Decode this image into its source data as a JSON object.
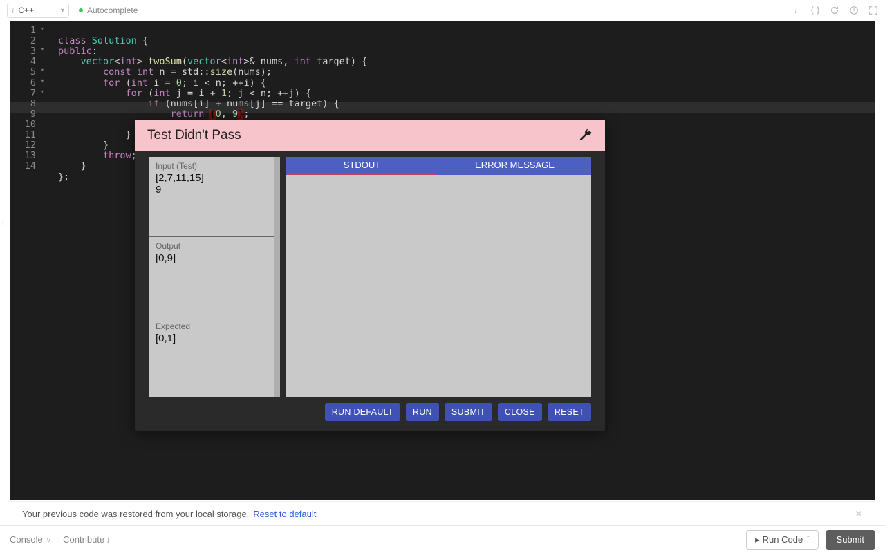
{
  "toolbar": {
    "language": "C++",
    "autocomplete": "Autocomplete"
  },
  "editor": {
    "lines": [
      {
        "n": 1,
        "fold": true
      },
      {
        "n": 2
      },
      {
        "n": 3,
        "fold": true
      },
      {
        "n": 4
      },
      {
        "n": 5,
        "fold": true
      },
      {
        "n": 6,
        "fold": true
      },
      {
        "n": 7,
        "fold": true
      },
      {
        "n": 8
      },
      {
        "n": 9
      },
      {
        "n": 10
      },
      {
        "n": 11
      },
      {
        "n": 12
      },
      {
        "n": 13
      },
      {
        "n": 14
      }
    ],
    "code": {
      "l1": "class Solution {",
      "l2": "public:",
      "l3": "    vector<int> twoSum(vector<int>& nums, int target) {",
      "l4": "        const int n = std::size(nums);",
      "l5": "        for (int i = 0; i < n; ++i) {",
      "l6": "            for (int j = i + 1; j < n; ++j) {",
      "l7": "                if (nums[i] + nums[j] == target) {",
      "l8a": "                    return ",
      "l8b": "{",
      "l8c": "0, 9",
      "l8d": "}",
      "l8e": ";",
      "l9": "                }",
      "l10": "            }",
      "l11": "        }",
      "l12": "        throw;",
      "l13": "    }",
      "l14": "};"
    }
  },
  "modal": {
    "title": "Test Didn't Pass",
    "input_label": "Input (Test)",
    "input_value": "[2,7,11,15]\n9",
    "output_label": "Output",
    "output_value": "[0,9]",
    "expected_label": "Expected",
    "expected_value": "[0,1]",
    "tab_stdout": "STDOUT",
    "tab_error": "ERROR MESSAGE",
    "btn_run_default": "RUN DEFAULT",
    "btn_run": "RUN",
    "btn_submit": "SUBMIT",
    "btn_close": "CLOSE",
    "btn_reset": "RESET"
  },
  "restore": {
    "text": "Your previous code was restored from your local storage.",
    "link": "Reset to default"
  },
  "bottom": {
    "console": "Console",
    "contribute": "Contribute",
    "run_code": "Run Code",
    "submit": "Submit"
  }
}
